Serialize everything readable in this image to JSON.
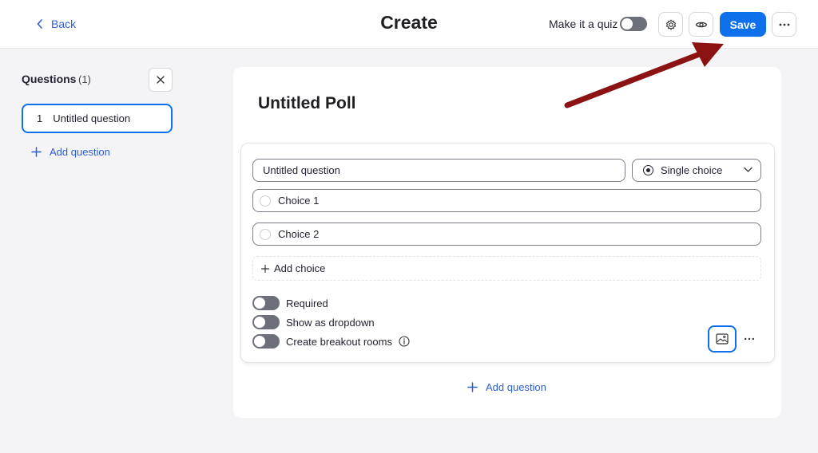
{
  "header": {
    "back_label": "Back",
    "title": "Create",
    "quiz_label": "Make it a quiz",
    "quiz_enabled": false,
    "save_label": "Save"
  },
  "sidebar": {
    "heading": "Questions",
    "count": "(1)",
    "items": [
      {
        "number": "1",
        "label": "Untitled question"
      }
    ],
    "add_label": "Add question"
  },
  "poll": {
    "title": "Untitled Poll",
    "question": {
      "text": "Untitled question",
      "type": "Single choice",
      "choices": [
        {
          "label": "Choice 1"
        },
        {
          "label": "Choice 2"
        }
      ],
      "add_choice_label": "Add choice",
      "options": [
        {
          "label": "Required",
          "enabled": false
        },
        {
          "label": "Show as dropdown",
          "enabled": false
        },
        {
          "label": "Create breakout rooms",
          "enabled": false
        }
      ]
    },
    "add_question_label": "Add question"
  },
  "colors": {
    "accent": "#0e71eb",
    "link": "#2d5ed9",
    "annotation_arrow": "#8b1313"
  },
  "icons": [
    "chevron-left-icon",
    "gear-icon",
    "eye-icon",
    "more-icon",
    "close-icon",
    "plus-icon",
    "chevron-down-icon",
    "info-icon",
    "image-icon"
  ]
}
